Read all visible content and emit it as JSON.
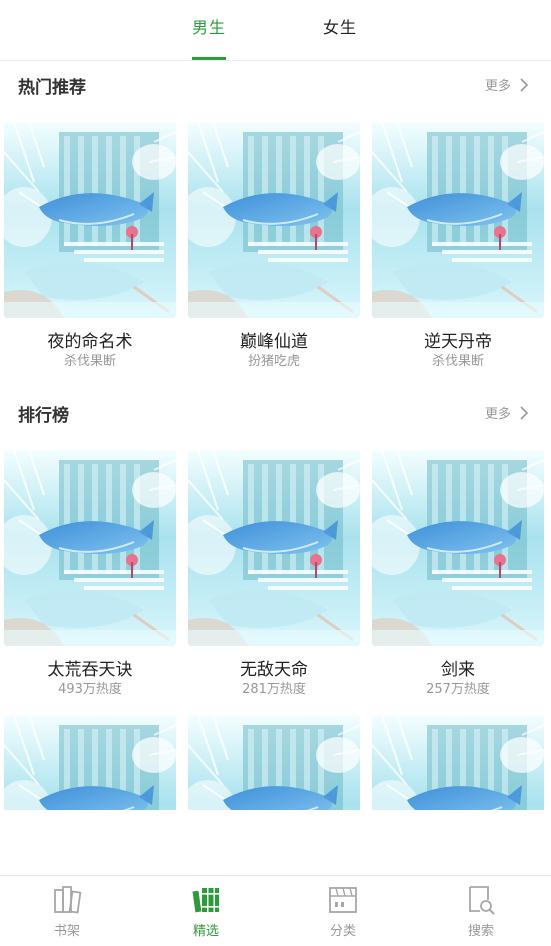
{
  "tabs": {
    "male": "男生",
    "female": "女生"
  },
  "sections": {
    "hot": {
      "title": "热门推荐",
      "more": "更多"
    },
    "rank": {
      "title": "排行榜",
      "more": "更多"
    }
  },
  "hot_books": [
    {
      "title": "夜的命名术",
      "author": "杀伐果断"
    },
    {
      "title": "巅峰仙道",
      "author": "扮猪吃虎"
    },
    {
      "title": "逆天丹帝",
      "author": "杀伐果断"
    }
  ],
  "rank_books": [
    {
      "title": "太荒吞天诀",
      "heat": "493万热度"
    },
    {
      "title": "无敌天命",
      "heat": "281万热度"
    },
    {
      "title": "剑来",
      "heat": "257万热度"
    }
  ],
  "nav": {
    "shelf": "书架",
    "featured": "精选",
    "category": "分类",
    "search": "搜索"
  },
  "colors": {
    "accent": "#2e9b3a",
    "muted": "#999999"
  }
}
